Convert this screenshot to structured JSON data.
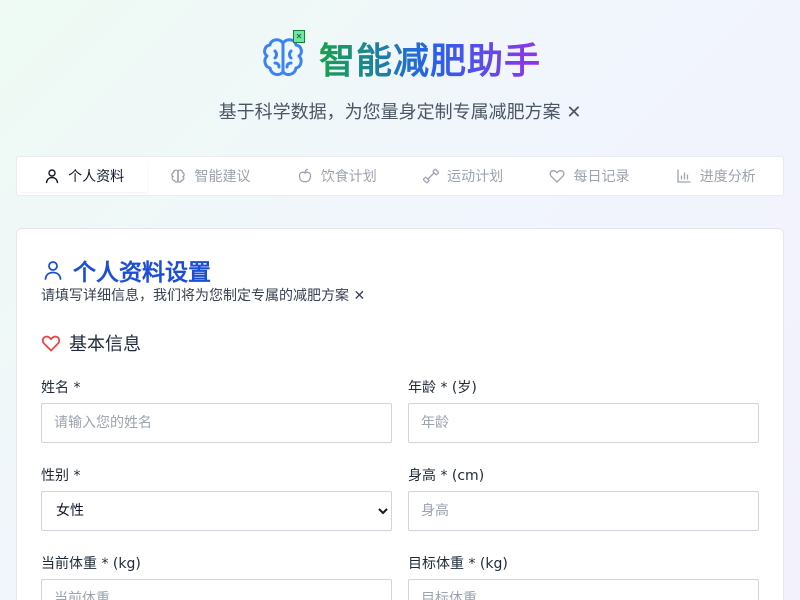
{
  "header": {
    "title": "智能减肥助手",
    "subtitle": "基于科学数据，为您量身定制专属减肥方案 ✕",
    "logo_icon": "brain-icon",
    "badge_glyph": "✕",
    "colors": {
      "green": "#16a34a",
      "blue": "#2563eb",
      "purple": "#9333ea"
    }
  },
  "tabs": [
    {
      "label": "个人资料",
      "icon": "user-icon",
      "active": true
    },
    {
      "label": "智能建议",
      "icon": "brain-icon",
      "active": false
    },
    {
      "label": "饮食计划",
      "icon": "apple-icon",
      "active": false
    },
    {
      "label": "运动计划",
      "icon": "dumbbell-icon",
      "active": false
    },
    {
      "label": "每日记录",
      "icon": "heart-icon",
      "active": false
    },
    {
      "label": "进度分析",
      "icon": "bar-chart-icon",
      "active": false
    }
  ],
  "profile": {
    "title": "个人资料设置",
    "description": "请填写详细信息，我们将为您制定专属的减肥方案 ✕",
    "section_title": "基本信息",
    "fields": {
      "name": {
        "label": "姓名 *",
        "placeholder": "请输入您的姓名",
        "value": ""
      },
      "age": {
        "label": "年龄 * (岁)",
        "placeholder": "年龄",
        "value": ""
      },
      "gender": {
        "label": "性别 *",
        "value": "女性",
        "options": [
          "女性"
        ]
      },
      "height": {
        "label": "身高 * (cm)",
        "placeholder": "身高",
        "value": ""
      },
      "current_weight": {
        "label": "当前体重 * (kg)",
        "placeholder": "当前体重",
        "value": ""
      },
      "target_weight": {
        "label": "目标体重 * (kg)",
        "placeholder": "目标体重",
        "value": ""
      }
    },
    "colors": {
      "accent_blue": "#1d4ed8",
      "heart_red": "#ef4444"
    }
  }
}
